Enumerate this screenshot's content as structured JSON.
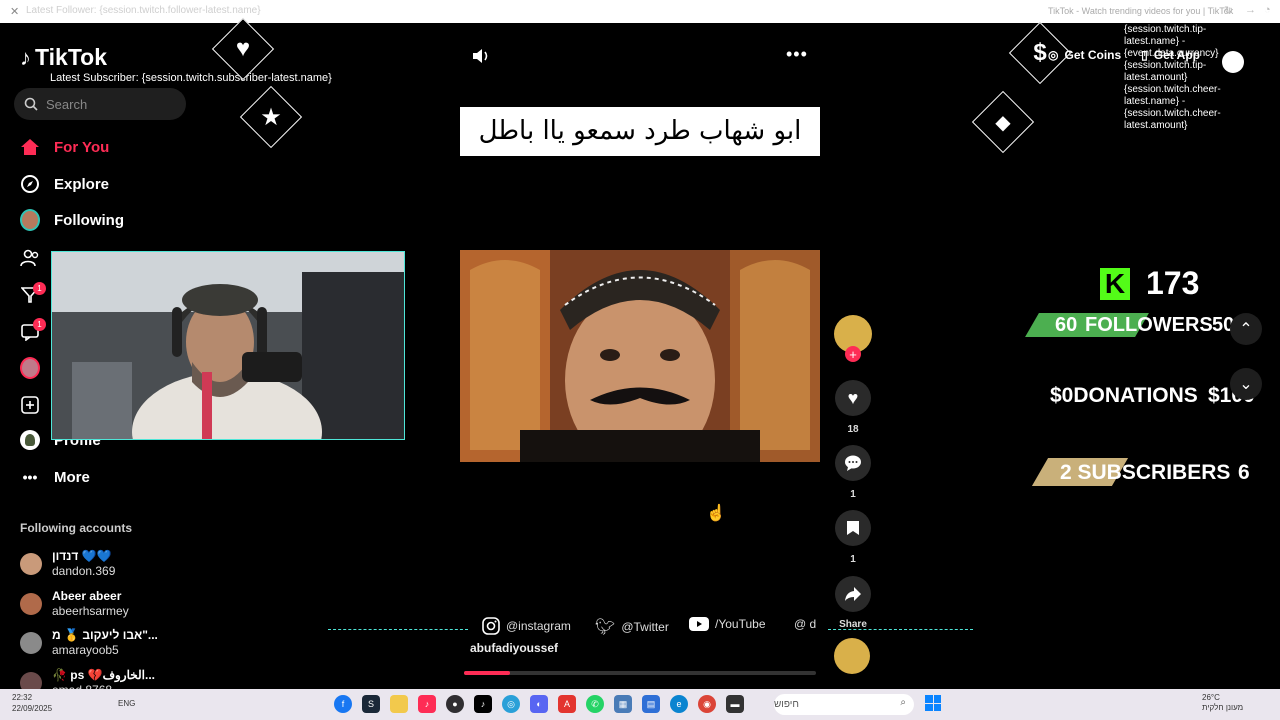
{
  "browser": {
    "url": "Latest Follower: {session.twitch.follower-latest.name}",
    "tab_title": "TikTok - Watch trending videos for you | TikTok"
  },
  "app": {
    "logo": "TikTok",
    "search_placeholder": "Search"
  },
  "overlays": {
    "latest_subscriber": "Latest Subscriber: {session.twitch.subscriber-latest.name}",
    "tip_text": "{session.twitch.tip-latest.name} - {event.data.currency}{session.twitch.tip-latest.amount} {session.twitch.cheer-latest.name} - {session.twitch.cheer-latest.amount}",
    "get_coins": "Get Coins",
    "get_app": "Get App",
    "followers_count": "173",
    "followers_label": "FOLLOWERS",
    "followers_left": "60",
    "followers_right": "50",
    "donations_label": "$0DONATIONS",
    "donations_right": "$100",
    "subscribers_label": "2 SUBSCRIBERS",
    "subscribers_right": "6"
  },
  "nav": {
    "for_you": "For You",
    "explore": "Explore",
    "following": "Following",
    "profile": "Profile",
    "more": "More",
    "badge_activity": "1",
    "badge_messages": "1"
  },
  "following_accounts": {
    "title": "Following accounts",
    "items": [
      {
        "name": "דנדון 💙💙",
        "user": "dandon.369",
        "color": "#c99a7a"
      },
      {
        "name": "Abeer abeer",
        "user": "abeerhsarmey",
        "color": "#b06a4a"
      },
      {
        "name": "אבו ליעקוב 🥇 מ\"...",
        "user": "amarayoob5",
        "color": "#8a8a8a"
      },
      {
        "name": "🥀 ps 💔الخاروف...",
        "user": "emad.8768",
        "color": "#6a4a4a"
      }
    ]
  },
  "video": {
    "caption": "ابو شهاب طرد سمعو ياا باطل",
    "author": "abufadiyoussef",
    "progress": 0.13
  },
  "actions": {
    "likes": "18",
    "comments": "1",
    "saves": "1",
    "share": "Share"
  },
  "social": {
    "instagram": "@instagram",
    "twitter": "@Twitter",
    "youtube": "/YouTube",
    "discord": "@ d"
  },
  "taskbar": {
    "time": "22:32",
    "date": "22/09/2025",
    "lang": "ENG",
    "search": "חיפוש",
    "weather_temp": "26°C",
    "weather_desc": "מעונן חלקית"
  }
}
